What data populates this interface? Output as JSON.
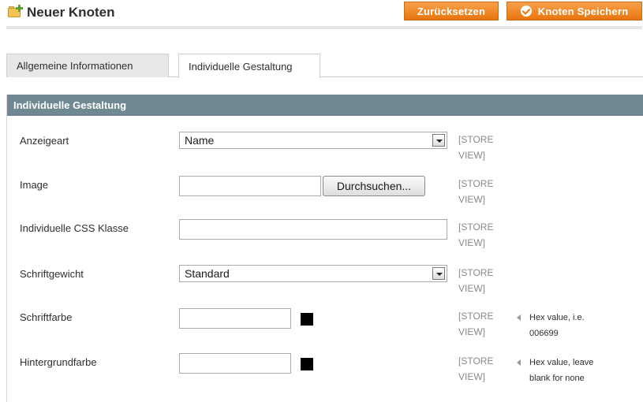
{
  "header": {
    "title": "Neuer Knoten",
    "reset_label": "Zurücksetzen",
    "save_label": "Knoten Speichern"
  },
  "tabs": [
    {
      "label": "Allgemeine Informationen",
      "active": false
    },
    {
      "label": "Individuelle Gestaltung",
      "active": true
    }
  ],
  "section": {
    "title": "Individuelle Gestaltung"
  },
  "scope_label": "[STORE VIEW]",
  "fields": {
    "display_type": {
      "label": "Anzeigeart",
      "selected": "Name",
      "scope_line1": "[STORE",
      "scope_line2": "VIEW]"
    },
    "image": {
      "label": "Image",
      "value": "",
      "browse_label": "Durchsuchen...",
      "scope_line1": "[STORE",
      "scope_line2": "VIEW]"
    },
    "css_class": {
      "label": "Individuelle CSS Klasse",
      "value": "",
      "scope_line1": "[STORE",
      "scope_line2": "VIEW]"
    },
    "font_weight": {
      "label": "Schriftgewicht",
      "selected": "Standard",
      "scope_line1": "[STORE",
      "scope_line2": "VIEW]"
    },
    "font_color": {
      "label": "Schriftfarbe",
      "value": "",
      "swatch_color": "#000000",
      "scope_line1": "[STORE",
      "scope_line2": "VIEW]",
      "note_line1": "Hex value, i.e.",
      "note_line2": "006699"
    },
    "bg_color": {
      "label": "Hintergrundfarbe",
      "value": "",
      "swatch_color": "#000000",
      "scope_line1": "[STORE",
      "scope_line2": "VIEW]",
      "note_line1": "Hex value, leave",
      "note_line2": "blank for none"
    }
  },
  "colors": {
    "accent_button": "#e8750e",
    "section_header": "#6f8992"
  }
}
